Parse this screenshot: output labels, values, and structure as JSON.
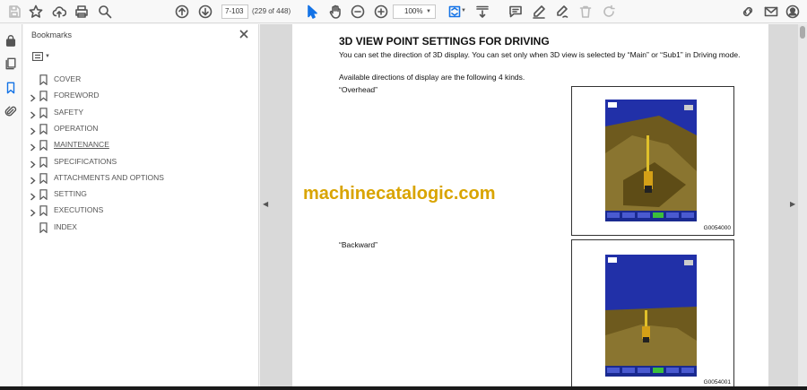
{
  "toolbar": {
    "page_input_value": "7-103",
    "page_count": "(229 of 448)",
    "zoom": "100%"
  },
  "panel": {
    "title": "Bookmarks",
    "bookmarks": [
      {
        "label": "COVER",
        "expandable": false
      },
      {
        "label": "FOREWORD",
        "expandable": true
      },
      {
        "label": "SAFETY",
        "expandable": true
      },
      {
        "label": "OPERATION",
        "expandable": true
      },
      {
        "label": "MAINTENANCE",
        "expandable": true
      },
      {
        "label": "SPECIFICATIONS",
        "expandable": true
      },
      {
        "label": "ATTACHMENTS AND OPTIONS",
        "expandable": true
      },
      {
        "label": "SETTING",
        "expandable": true
      },
      {
        "label": "EXECUTIONS",
        "expandable": true
      },
      {
        "label": "INDEX",
        "expandable": false
      }
    ]
  },
  "document": {
    "heading": "3D VIEW POINT SETTINGS FOR DRIVING",
    "para1": "You can set the direction of 3D display. You can set only when 3D view is selected by “Main” or “Sub1” in Driving mode.",
    "para2": "Available directions of display are the following 4 kinds.",
    "label_overhead": "“Overhead”",
    "label_backward": "“Backward”",
    "figure1_code": "G0054000",
    "figure2_code": "G0054001",
    "watermark": "machinecatalogic.com"
  },
  "colors": {
    "accent": "#1473e6",
    "watermark": "#d9a400",
    "screen_sky": "#2130a8",
    "screen_ground": "#6e5a1e"
  }
}
